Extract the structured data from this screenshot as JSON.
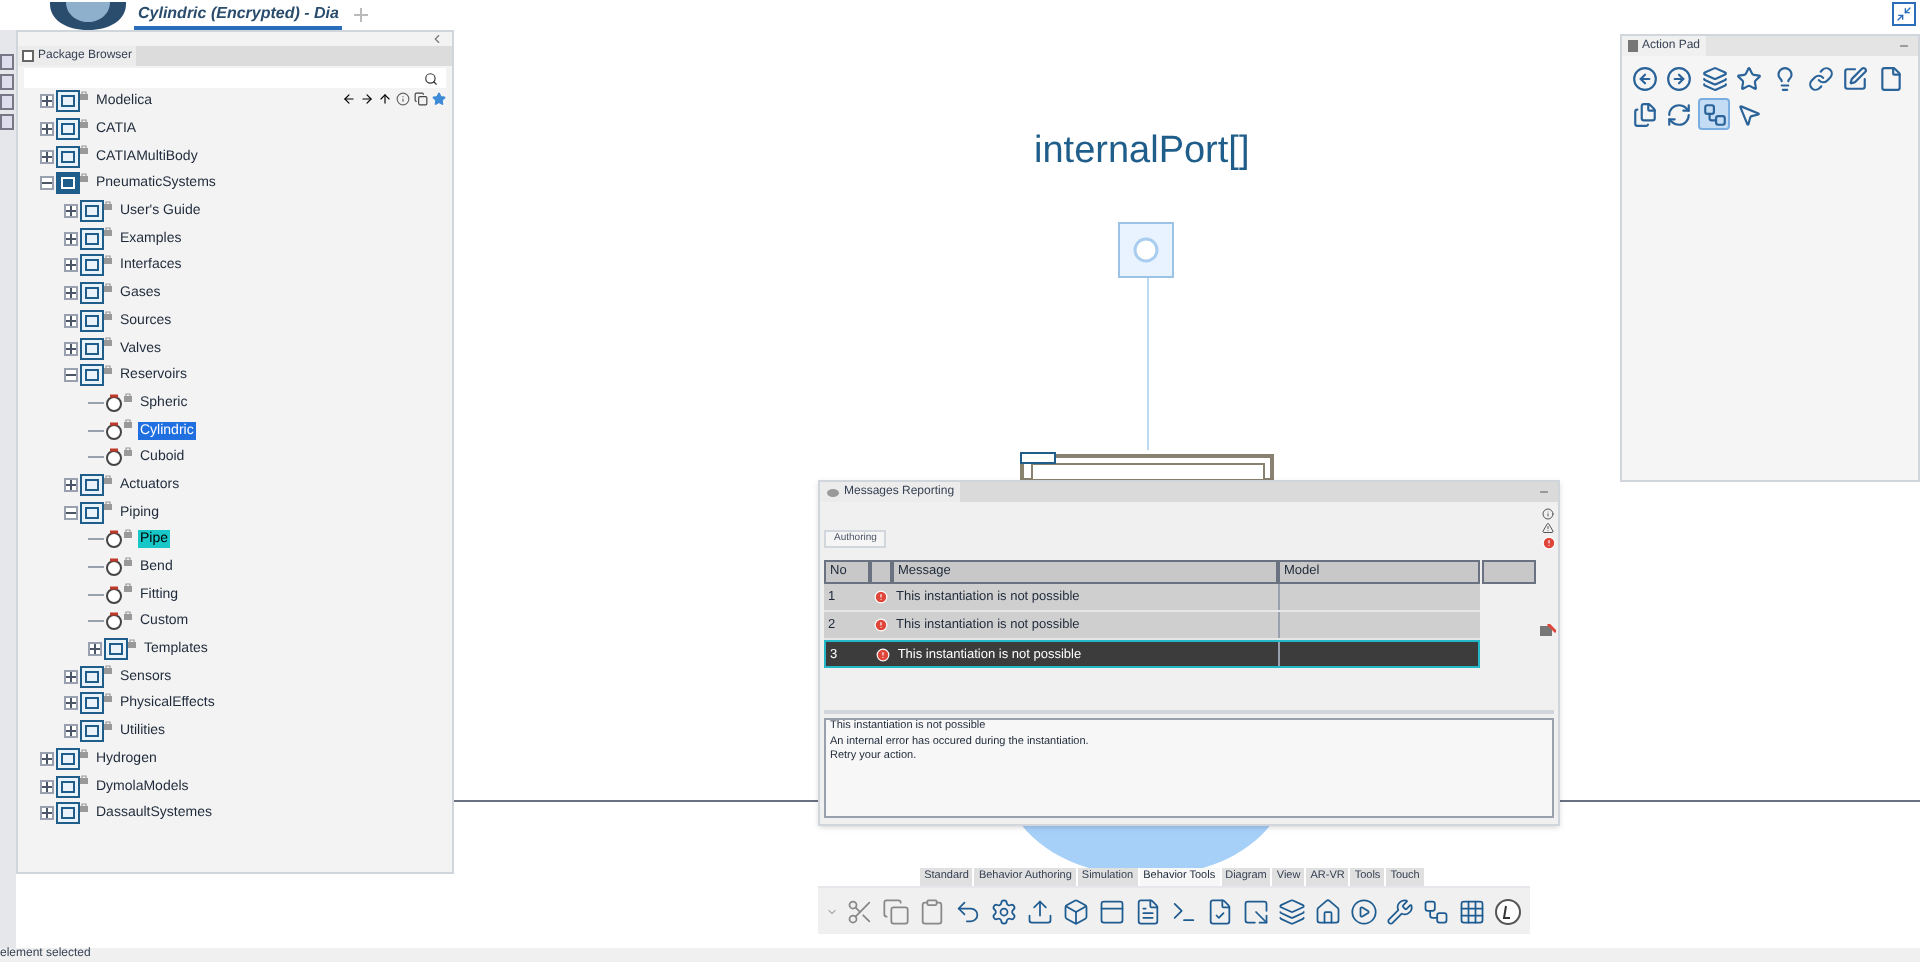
{
  "document_tab": {
    "title": "Cylindric (Encrypted) - Dia"
  },
  "package_browser": {
    "title": "Package Browser",
    "tree": [
      {
        "label": "Modelica",
        "kind": "package",
        "expanded": false,
        "selected": false,
        "highlighted": false
      },
      {
        "label": "CATIA",
        "kind": "package",
        "expanded": false,
        "selected": false,
        "highlighted": false
      },
      {
        "label": "CATIAMultiBody",
        "kind": "package",
        "expanded": false,
        "selected": false,
        "highlighted": false
      },
      {
        "label": "PneumaticSystems",
        "kind": "package",
        "expanded": true,
        "selected": false,
        "highlighted": false,
        "children": [
          {
            "label": "User's Guide",
            "kind": "package",
            "expanded": false,
            "selected": false,
            "highlighted": false
          },
          {
            "label": "Examples",
            "kind": "package",
            "expanded": false,
            "selected": false,
            "highlighted": false
          },
          {
            "label": "Interfaces",
            "kind": "package",
            "expanded": false,
            "selected": false,
            "highlighted": false
          },
          {
            "label": "Gases",
            "kind": "package",
            "expanded": false,
            "selected": false,
            "highlighted": false
          },
          {
            "label": "Sources",
            "kind": "package",
            "expanded": false,
            "selected": false,
            "highlighted": false
          },
          {
            "label": "Valves",
            "kind": "package",
            "expanded": false,
            "selected": false,
            "highlighted": false
          },
          {
            "label": "Reservoirs",
            "kind": "package",
            "expanded": true,
            "selected": false,
            "highlighted": false,
            "children": [
              {
                "label": "Spheric",
                "kind": "model",
                "selected": false,
                "highlighted": false
              },
              {
                "label": "Cylindric",
                "kind": "model",
                "selected": true,
                "highlighted": false
              },
              {
                "label": "Cuboid",
                "kind": "model",
                "selected": false,
                "highlighted": false
              }
            ]
          },
          {
            "label": "Actuators",
            "kind": "package",
            "expanded": false,
            "selected": false,
            "highlighted": false
          },
          {
            "label": "Piping",
            "kind": "package",
            "expanded": true,
            "selected": false,
            "highlighted": false,
            "children": [
              {
                "label": "Pipe",
                "kind": "model",
                "selected": false,
                "highlighted": true
              },
              {
                "label": "Bend",
                "kind": "model",
                "selected": false,
                "highlighted": false
              },
              {
                "label": "Fitting",
                "kind": "model",
                "selected": false,
                "highlighted": false
              },
              {
                "label": "Custom",
                "kind": "model",
                "selected": false,
                "highlighted": false
              },
              {
                "label": "Templates",
                "kind": "package",
                "expanded": false,
                "selected": false,
                "highlighted": false
              }
            ]
          },
          {
            "label": "Sensors",
            "kind": "package",
            "expanded": false,
            "selected": false,
            "highlighted": false
          },
          {
            "label": "PhysicalEffects",
            "kind": "package",
            "expanded": false,
            "selected": false,
            "highlighted": false
          },
          {
            "label": "Utilities",
            "kind": "package",
            "expanded": false,
            "selected": false,
            "highlighted": false
          }
        ]
      },
      {
        "label": "Hydrogen",
        "kind": "package",
        "expanded": false,
        "selected": false,
        "highlighted": false
      },
      {
        "label": "DymolaModels",
        "kind": "package",
        "expanded": false,
        "selected": false,
        "highlighted": false
      },
      {
        "label": "DassaultSystemes",
        "kind": "package",
        "expanded": false,
        "selected": false,
        "highlighted": false
      }
    ]
  },
  "diagram": {
    "title": "internalPort[]"
  },
  "action_pad": {
    "title": "Action Pad",
    "tools": [
      {
        "kind": "back",
        "selected": false
      },
      {
        "kind": "forward",
        "selected": false
      },
      {
        "kind": "layers",
        "selected": false
      },
      {
        "kind": "star",
        "selected": false
      },
      {
        "kind": "bulb",
        "selected": false
      },
      {
        "kind": "link",
        "selected": false
      },
      {
        "kind": "edit",
        "selected": false
      },
      {
        "kind": "file",
        "selected": false
      },
      {
        "kind": "copy",
        "selected": false
      },
      {
        "kind": "refresh",
        "selected": false
      },
      {
        "kind": "connector",
        "selected": true
      },
      {
        "kind": "pointer",
        "selected": false
      }
    ]
  },
  "messages": {
    "title": "Messages Reporting",
    "tab": "Authoring",
    "columns": [
      "No",
      "Message",
      "Model"
    ],
    "rows": [
      {
        "no": "1",
        "message": "This instantiation is not possible",
        "selected": false
      },
      {
        "no": "2",
        "message": "This instantiation is not possible",
        "selected": false
      },
      {
        "no": "3",
        "message": "This instantiation is not possible",
        "selected": true
      }
    ],
    "details": [
      "This instantiation is not possible",
      "An internal error has occured during the instantiation.",
      "Retry your action."
    ]
  },
  "toolbar_tabs": [
    {
      "label": "Standard",
      "selected": false
    },
    {
      "label": "Behavior Authoring",
      "selected": false
    },
    {
      "label": "Simulation",
      "selected": false
    },
    {
      "label": "Behavior Tools",
      "selected": true
    },
    {
      "label": "Diagram",
      "selected": false
    },
    {
      "label": "View",
      "selected": false
    },
    {
      "label": "AR-VR",
      "selected": false
    },
    {
      "label": "Tools",
      "selected": false
    },
    {
      "label": "Touch",
      "selected": false
    }
  ],
  "status_bar": {
    "text": "element selected"
  }
}
